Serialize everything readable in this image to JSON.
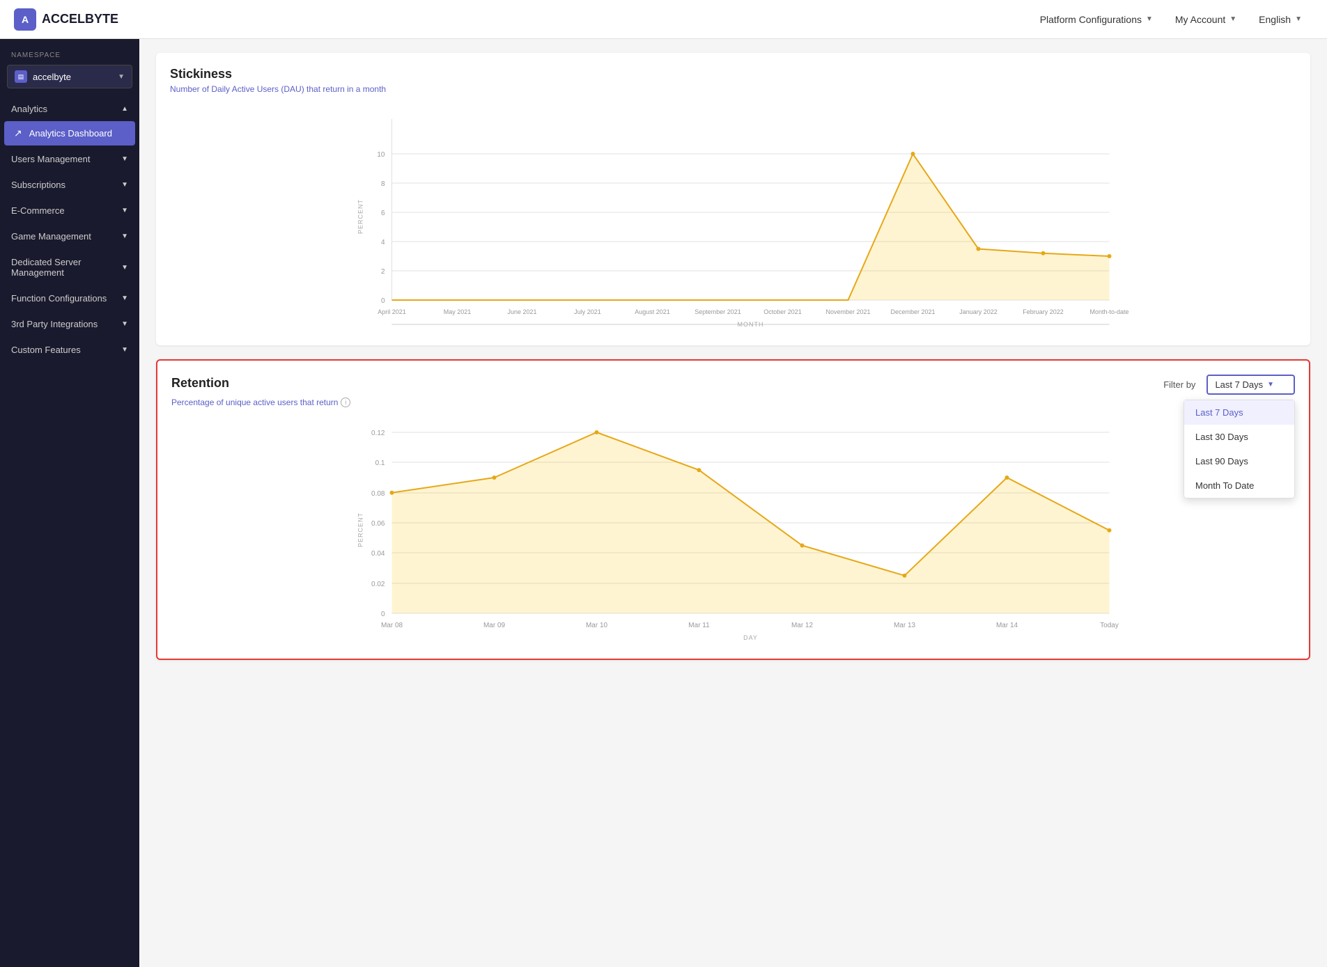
{
  "header": {
    "logo_text": "ACCELBYTE",
    "logo_icon": "A",
    "nav_items": [
      {
        "label": "Platform Configurations",
        "key": "platform-configs"
      },
      {
        "label": "My Account",
        "key": "my-account"
      },
      {
        "label": "English",
        "key": "language"
      }
    ]
  },
  "sidebar": {
    "namespace_label": "NAMESPACE",
    "namespace_value": "accelbyte",
    "sections": [
      {
        "label": "Analytics",
        "key": "analytics",
        "expanded": true,
        "items": [
          {
            "label": "Analytics Dashboard",
            "key": "analytics-dashboard",
            "active": true,
            "icon": "📈"
          }
        ]
      },
      {
        "label": "Users Management",
        "key": "users-management",
        "expanded": false,
        "items": []
      },
      {
        "label": "Subscriptions",
        "key": "subscriptions",
        "expanded": false,
        "items": []
      },
      {
        "label": "E-Commerce",
        "key": "ecommerce",
        "expanded": false,
        "items": []
      },
      {
        "label": "Game Management",
        "key": "game-management",
        "expanded": false,
        "items": []
      },
      {
        "label": "Dedicated Server Management",
        "key": "dedicated-server",
        "expanded": false,
        "items": []
      },
      {
        "label": "Function Configurations",
        "key": "function-configs",
        "expanded": false,
        "items": []
      },
      {
        "label": "3rd Party Integrations",
        "key": "3rd-party",
        "expanded": false,
        "items": []
      },
      {
        "label": "Custom Features",
        "key": "custom-features",
        "expanded": false,
        "items": []
      }
    ]
  },
  "stickiness_chart": {
    "title": "Stickiness",
    "subtitle": "Number of Daily Active Users (DAU) that return in a month",
    "y_axis_label": "PERCENT",
    "x_axis_label": "MONTH",
    "x_labels": [
      "April 2021",
      "May 2021",
      "June 2021",
      "July 2021",
      "August 2021",
      "September 2021",
      "October 2021",
      "November 2021",
      "December 2021",
      "January 2022",
      "February 2022",
      "Month-to-date"
    ],
    "y_labels": [
      "0",
      "2",
      "4",
      "6",
      "8",
      "10"
    ],
    "data_points": [
      {
        "x": 0,
        "y": 0
      },
      {
        "x": 1,
        "y": 0
      },
      {
        "x": 2,
        "y": 0
      },
      {
        "x": 3,
        "y": 0
      },
      {
        "x": 4,
        "y": 0
      },
      {
        "x": 5,
        "y": 0
      },
      {
        "x": 6,
        "y": 0
      },
      {
        "x": 7,
        "y": 0
      },
      {
        "x": 8,
        "y": 10
      },
      {
        "x": 9,
        "y": 3.5
      },
      {
        "x": 10,
        "y": 3.2
      },
      {
        "x": 11,
        "y": 3.0
      }
    ]
  },
  "retention_chart": {
    "title": "Retention",
    "subtitle": "Percentage of unique active users that return",
    "filter_label": "Filter by",
    "selected_filter": "Last 7 Days",
    "y_axis_label": "PERCENT",
    "x_axis_label": "DAY",
    "x_labels": [
      "Mar 08",
      "Mar 09",
      "Mar 10",
      "Mar 11",
      "Mar 12",
      "Mar 13",
      "Mar 14",
      "Today"
    ],
    "y_labels": [
      "0",
      "0.02",
      "0.04",
      "0.06",
      "0.08",
      "0.1",
      "0.12"
    ],
    "data_points": [
      {
        "x": 0,
        "y": 0.08
      },
      {
        "x": 1,
        "y": 0.09
      },
      {
        "x": 2,
        "y": 0.12
      },
      {
        "x": 3,
        "y": 0.095
      },
      {
        "x": 4,
        "y": 0.045
      },
      {
        "x": 5,
        "y": 0.025
      },
      {
        "x": 6,
        "y": 0.09
      },
      {
        "x": 7,
        "y": 0.055
      }
    ],
    "dropdown_options": [
      {
        "label": "Last 7 Days",
        "selected": true
      },
      {
        "label": "Last 30 Days",
        "selected": false
      },
      {
        "label": "Last 90 Days",
        "selected": false
      },
      {
        "label": "Month To Date",
        "selected": false
      }
    ]
  }
}
